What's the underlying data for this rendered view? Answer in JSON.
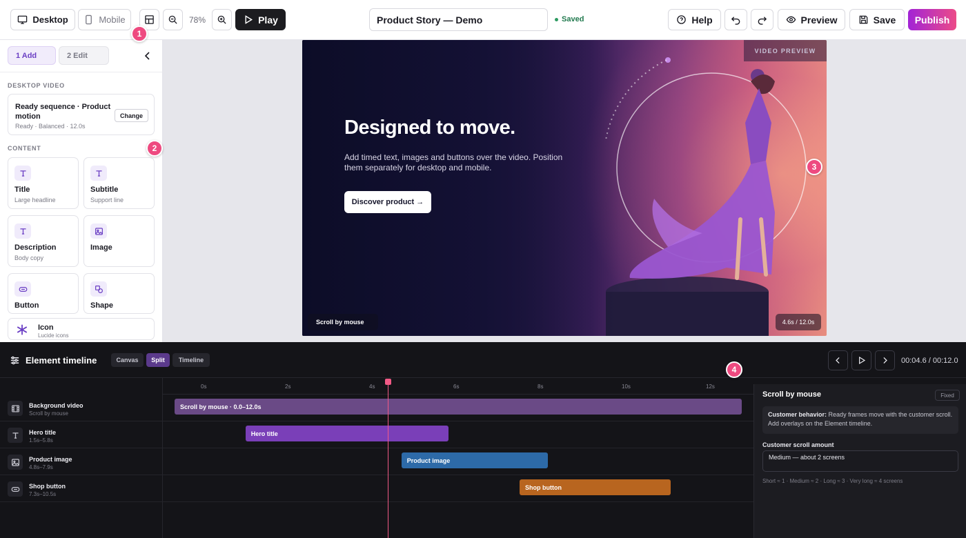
{
  "topbar": {
    "desktop_label": "Desktop",
    "mobile_label": "Mobile",
    "zoom": "78%",
    "play_label": "Play",
    "doc_title": "Product Story — Demo",
    "saved_label": "Saved",
    "help_label": "Help",
    "preview_label": "Preview",
    "save_label": "Save",
    "publish_label": "Publish"
  },
  "markers": [
    "1",
    "2",
    "3",
    "4"
  ],
  "sidebar": {
    "tab_add": "1 Add",
    "tab_edit": "2 Edit",
    "section_video": "DESKTOP VIDEO",
    "video_card": {
      "title": "Ready sequence · Product motion",
      "subtitle": "Ready · Balanced · 12.0s",
      "change_label": "Change"
    },
    "section_content": "CONTENT",
    "items": [
      {
        "name": "Title",
        "desc": "Large headline",
        "icon": "text-icon"
      },
      {
        "name": "Subtitle",
        "desc": "Support line",
        "icon": "text-icon"
      },
      {
        "name": "Description",
        "desc": "Body copy",
        "icon": "text-icon"
      },
      {
        "name": "Image",
        "desc": "",
        "icon": "image-icon"
      },
      {
        "name": "Button",
        "desc": "",
        "icon": "button-icon"
      },
      {
        "name": "Shape",
        "desc": "",
        "icon": "shapes-icon"
      }
    ],
    "icon_item": {
      "name": "Icon",
      "desc": "Lucide icons"
    }
  },
  "video": {
    "tag": "VIDEO PREVIEW",
    "headline": "Designed to move.",
    "body": "Add timed text, images and buttons over the video. Position them separately for desktop and mobile.",
    "cta": "Discover product →",
    "mode_pill": "Scroll by mouse",
    "time_pill": "4.6s / 12.0s"
  },
  "timeline": {
    "title": "Element timeline",
    "views": [
      "Canvas",
      "Split",
      "Timeline"
    ],
    "active_view": "Split",
    "timecode": "00:04.6 / 00:12.0",
    "ticks": [
      "0s",
      "2s",
      "4s",
      "6s",
      "8s",
      "10s",
      "12s"
    ],
    "rows": [
      {
        "name": "Background video",
        "sub": "Scroll by mouse",
        "bar": "Scroll by mouse · 0.0–12.0s",
        "start": 0.0,
        "end": 12.0,
        "color": "#6a4a86",
        "icon": "film-icon"
      },
      {
        "name": "Hero title",
        "sub": "1.5s–5.8s",
        "bar": "Hero title",
        "start": 1.5,
        "end": 5.8,
        "color": "#7a3fb8",
        "icon": "text-icon"
      },
      {
        "name": "Product image",
        "sub": "4.8s–7.9s",
        "bar": "Product image",
        "start": 4.8,
        "end": 7.9,
        "color": "#2d6aa8",
        "icon": "image-icon"
      },
      {
        "name": "Shop button",
        "sub": "7.3s–10.5s",
        "bar": "Shop button",
        "start": 7.3,
        "end": 10.5,
        "color": "#b8651f",
        "icon": "button-icon"
      }
    ],
    "playhead_time": 4.6
  },
  "inspector": {
    "title": "Scroll by mouse",
    "badge": "Fixed",
    "behavior_label": "Customer behavior:",
    "behavior_text": "Ready frames move with the customer scroll. Add overlays on the Element timeline.",
    "amount_label": "Customer scroll amount",
    "amount_value": "Medium — about 2 screens",
    "amount_hint": "Short ≈ 1 · Medium ≈ 2 · Long ≈ 3 · Very long ≈ 4 screens"
  },
  "colors": {
    "accent": "#6b3fc4",
    "marker": "#ee4a80",
    "playhead": "#f25a86",
    "saved": "#227a4f"
  }
}
